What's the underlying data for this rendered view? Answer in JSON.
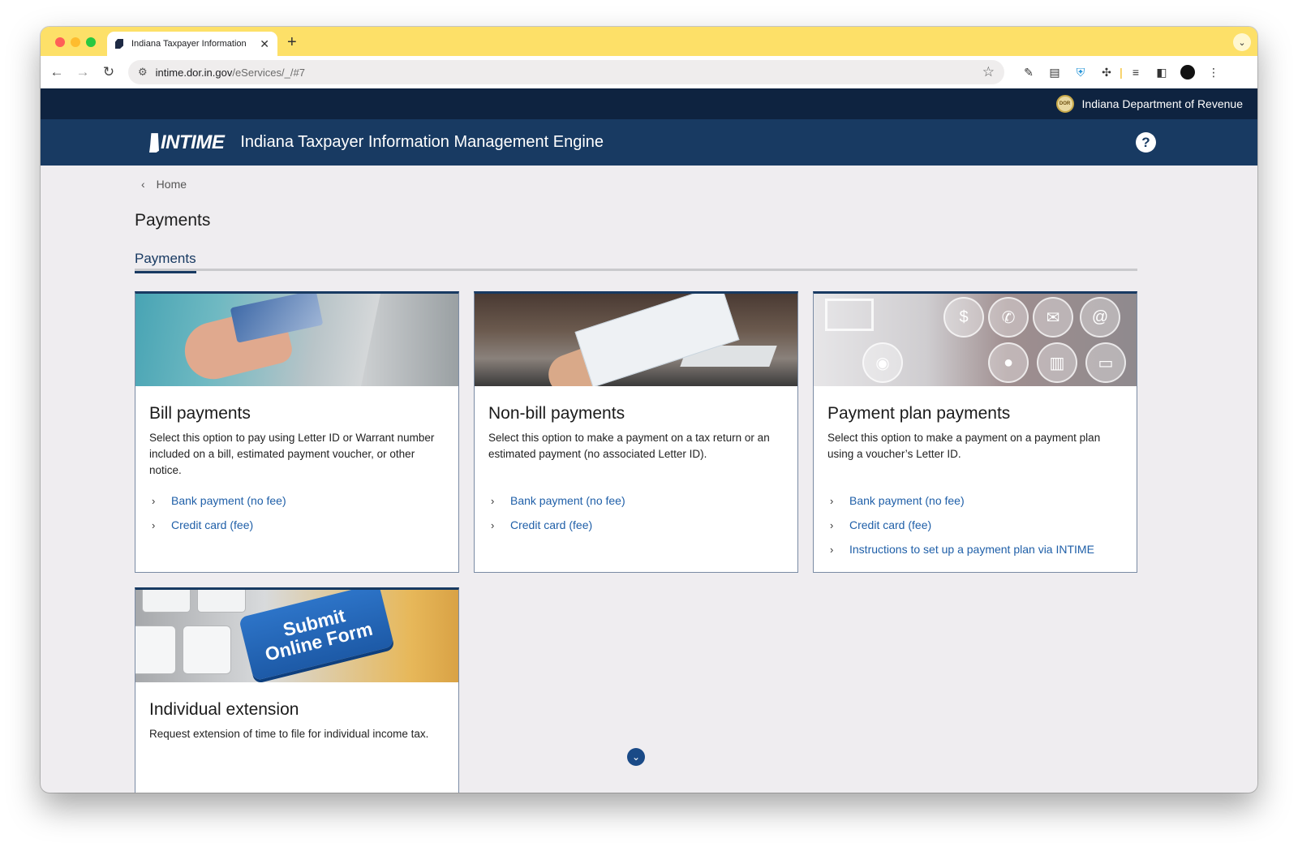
{
  "browser": {
    "tab_title": "Indiana Taxpayer Information",
    "url_host": "intime.dor.in.gov",
    "url_path": "/eServices/_/#7"
  },
  "dor_bar": {
    "agency_name": "Indiana Department of Revenue",
    "seal_text": "DOR"
  },
  "header": {
    "logo_text": "INTIME",
    "app_title": "Indiana Taxpayer Information Management Engine",
    "help_symbol": "?"
  },
  "breadcrumb": {
    "home": "Home"
  },
  "page": {
    "title": "Payments",
    "active_tab": "Payments"
  },
  "cards": [
    {
      "title": "Bill payments",
      "description": "Select this option to pay using Letter ID or Warrant number included on a bill, estimated payment voucher, or other notice.",
      "links": [
        "Bank payment (no fee)",
        "Credit card (fee)"
      ]
    },
    {
      "title": "Non-bill payments",
      "description": "Select this option to make a payment on a tax return or an estimated payment (no associated Letter ID).",
      "links": [
        "Bank payment (no fee)",
        "Credit card (fee)"
      ]
    },
    {
      "title": "Payment plan payments",
      "description": "Select this option to make a payment on a payment plan using a voucher’s Letter ID.",
      "links": [
        "Bank payment (no fee)",
        "Credit card (fee)",
        "Instructions to set up a payment plan via INTIME"
      ]
    },
    {
      "title": "Individual extension",
      "description": "Request extension of time to file for individual income tax.",
      "image_text_line1": "Submit",
      "image_text_line2": "Online Form",
      "links": []
    }
  ],
  "colors": {
    "tab_strip": "#fde068",
    "dor_bar": "#0e2340",
    "header": "#183a62",
    "link": "#1f5fa8",
    "page_bg": "#efedf0"
  },
  "icons": [
    "back-arrow-icon",
    "forward-arrow-icon",
    "reload-icon",
    "site-info-icon",
    "bookmark-star-icon",
    "help-icon",
    "chevron-left-icon",
    "chevron-right-icon",
    "chevron-down-icon"
  ]
}
